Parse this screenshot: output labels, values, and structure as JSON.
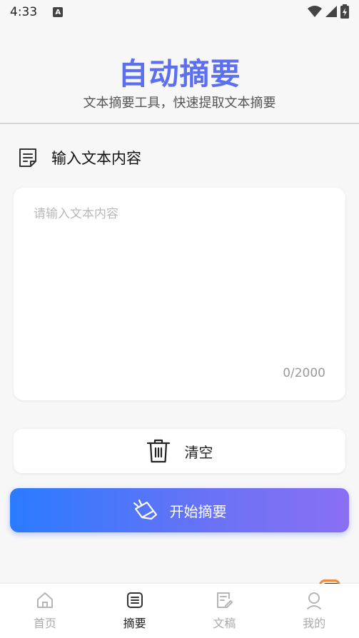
{
  "status_bar": {
    "time": "4:33",
    "indicator": "A"
  },
  "header": {
    "title": "自动摘要",
    "subtitle": "文本摘要工具，快速提取文本摘要"
  },
  "input_section": {
    "title": "输入文本内容",
    "placeholder": "请输入文本内容",
    "char_count": "0/2000"
  },
  "buttons": {
    "clear": "清空",
    "start": "开始摘要"
  },
  "colors": {
    "accent": "#5b6ff0",
    "gradient_start": "#2a7bff",
    "gradient_end": "#8a6ff3"
  },
  "tabs": [
    {
      "label": "首页",
      "icon": "home-icon",
      "active": false
    },
    {
      "label": "摘要",
      "icon": "summary-icon",
      "active": true
    },
    {
      "label": "文稿",
      "icon": "document-edit-icon",
      "active": false
    },
    {
      "label": "我的",
      "icon": "profile-icon",
      "active": false
    }
  ]
}
